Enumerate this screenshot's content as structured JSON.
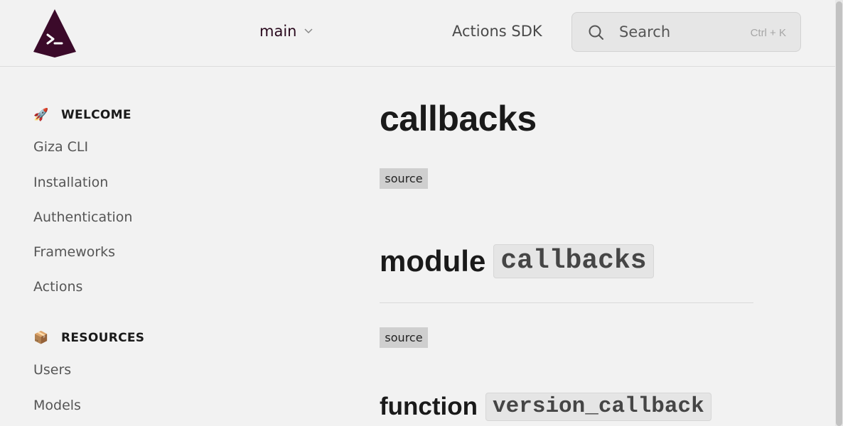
{
  "header": {
    "version": "main",
    "nav_link": "Actions SDK",
    "search": {
      "placeholder": "Search",
      "shortcut": "Ctrl + K"
    }
  },
  "sidebar": {
    "sections": [
      {
        "title": "WELCOME",
        "icon": "rocket-icon",
        "emoji": "🚀",
        "items": [
          "Giza CLI",
          "Installation",
          "Authentication",
          "Frameworks",
          "Actions"
        ]
      },
      {
        "title": "RESOURCES",
        "icon": "package-icon",
        "emoji": "📦",
        "items": [
          "Users",
          "Models"
        ]
      }
    ]
  },
  "content": {
    "title": "callbacks",
    "source_label": "source",
    "module_heading": {
      "keyword": "module",
      "name": "callbacks"
    },
    "source_label_2": "source",
    "function_heading": {
      "keyword": "function",
      "name": "version_callback"
    }
  },
  "colors": {
    "background": "#f2f2f2",
    "brand": "#3b0a2a",
    "badge": "#cfcfcf"
  }
}
